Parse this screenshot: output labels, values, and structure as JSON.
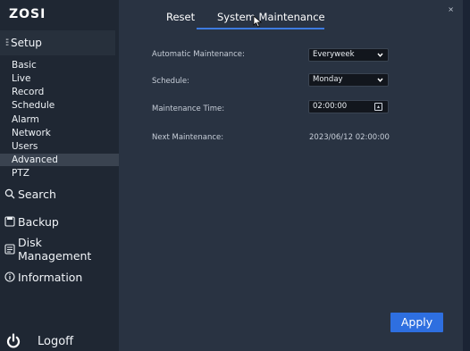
{
  "brand": {
    "logo_text": "ZOSI"
  },
  "sidebar": {
    "setup_label": "Setup",
    "sub_items": [
      {
        "label": "Basic"
      },
      {
        "label": "Live"
      },
      {
        "label": "Record"
      },
      {
        "label": "Schedule"
      },
      {
        "label": "Alarm"
      },
      {
        "label": "Network"
      },
      {
        "label": "Users"
      },
      {
        "label": "Advanced",
        "active": true
      },
      {
        "label": "PTZ"
      }
    ],
    "nav_items": [
      {
        "label": "Search",
        "icon": "search-icon"
      },
      {
        "label": "Backup",
        "icon": "backup-icon"
      },
      {
        "label": "Disk Management",
        "icon": "disk-icon"
      },
      {
        "label": "Information",
        "icon": "info-icon"
      }
    ],
    "logoff_label": "Logoff"
  },
  "tabs": [
    {
      "label": "Reset"
    },
    {
      "label": "System Maintenance",
      "active": true
    }
  ],
  "form": {
    "automatic_maintenance": {
      "label": "Automatic Maintenance:",
      "value": "Everyweek"
    },
    "schedule": {
      "label": "Schedule:",
      "value": "Monday"
    },
    "maintenance_time": {
      "label": "Maintenance Time:",
      "value": "02:00:00"
    },
    "next_maintenance": {
      "label": "Next Maintenance:",
      "value": "2023/06/12 02:00:00"
    }
  },
  "actions": {
    "apply_label": "Apply",
    "close_symbol": "×"
  },
  "colors": {
    "accent": "#2e6fe0",
    "tab_underline": "#3d7be0",
    "panel": "#293342",
    "sidebar": "#1f2733"
  }
}
